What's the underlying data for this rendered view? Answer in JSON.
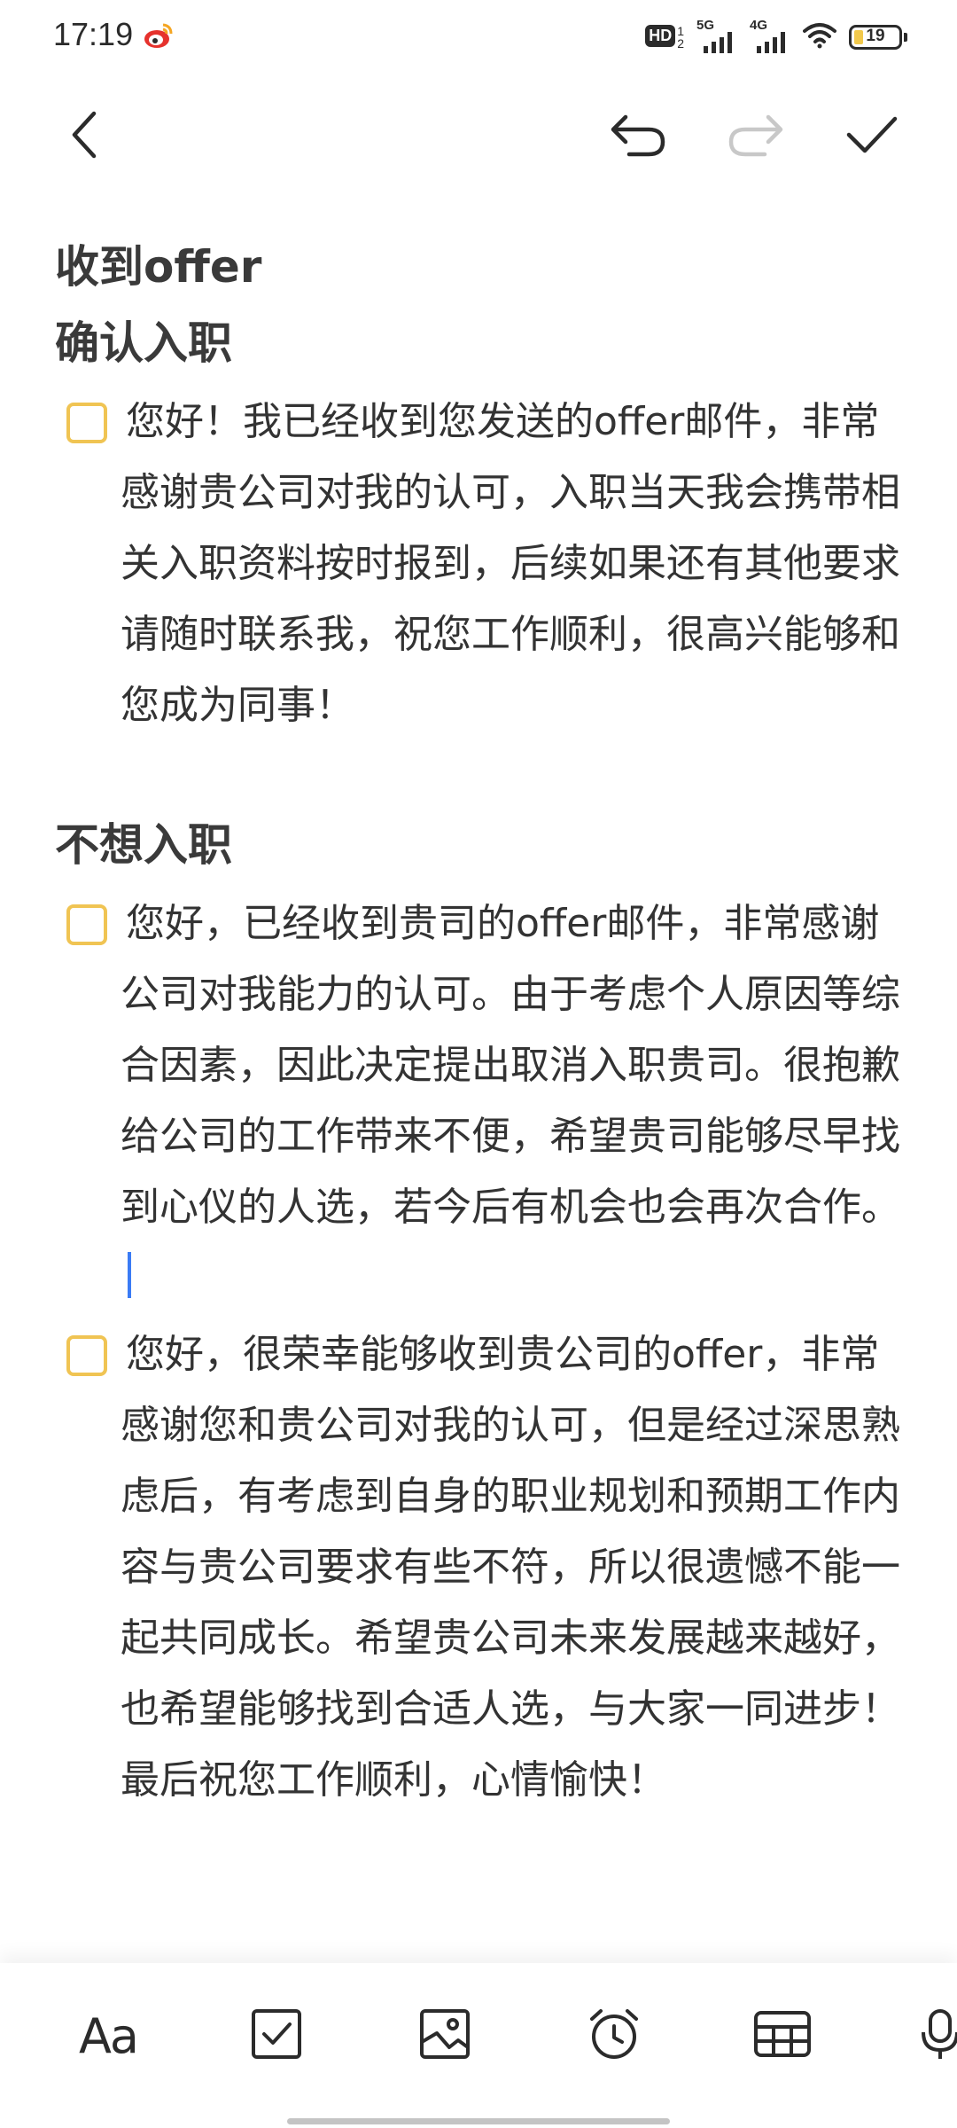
{
  "status_bar": {
    "time": "17:19",
    "hd_label": "HD",
    "hd_sub": "1\n2",
    "signal1_label": "5G",
    "signal2_label": "4G",
    "battery_level": "19",
    "app_icon": "weibo-icon"
  },
  "toolbar": {
    "back_icon": "back-arrow-icon",
    "undo_icon": "undo-icon",
    "redo_icon": "redo-icon",
    "done_icon": "check-icon",
    "redo_enabled": false
  },
  "note": {
    "title": "收到offer",
    "section1": {
      "heading": "确认入职",
      "items": [
        {
          "checked": false,
          "text": "您好！我已经收到您发送的offer邮件，非常感谢贵公司对我的认可，入职当天我会携带相关入职资料按时报到，后续如果还有其他要求请随时联系我，祝您工作顺利，很高兴能够和您成为同事！"
        }
      ]
    },
    "section2": {
      "heading": "不想入职",
      "items": [
        {
          "checked": false,
          "text": "您好，已经收到贵司的offer邮件，非常感谢公司对我能力的认可。由于考虑个人原因等综合因素，因此决定提出取消入职贵司。很抱歉给公司的工作带来不便，希望贵司能够尽早找到心仪的人选，若今后有机会也会再次合作。"
        },
        {
          "checked": false,
          "text": "您好，很荣幸能够收到贵公司的offer，非常感谢您和贵公司对我的认可，但是经过深思熟虑后，有考虑到自身的职业规划和预期工作内容与贵公司要求有些不符，所以很遗憾不能一起共同成长。希望贵公司未来发展越来越好，也希望能够找到合适人选，与大家一同进步！最后祝您工作顺利，心情愉快！"
        }
      ]
    }
  },
  "bottom_toolbar": {
    "text_style_label": "Aa",
    "items": [
      "text-style-icon",
      "checklist-icon",
      "image-icon",
      "alarm-clock-icon",
      "table-icon",
      "microphone-icon"
    ]
  },
  "colors": {
    "checkbox_border": "#f0c453",
    "caret": "#3a7bf5",
    "text": "#333333",
    "disabled_icon": "#c8c8c8"
  }
}
